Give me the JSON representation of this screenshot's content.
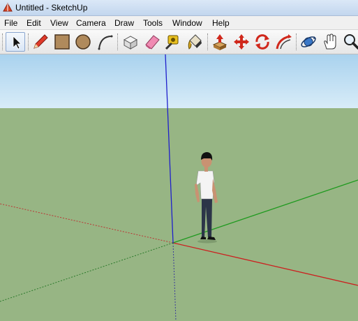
{
  "window": {
    "title": "Untitled - SketchUp",
    "app_icon": "sketchup-logo-icon"
  },
  "menu": [
    {
      "label": "File"
    },
    {
      "label": "Edit"
    },
    {
      "label": "View"
    },
    {
      "label": "Camera"
    },
    {
      "label": "Draw"
    },
    {
      "label": "Tools"
    },
    {
      "label": "Window"
    },
    {
      "label": "Help"
    }
  ],
  "toolbar": {
    "tools": [
      {
        "name": "select-tool",
        "icon": "arrow-cursor-icon"
      },
      {
        "name": "line-tool",
        "icon": "pencil-icon"
      },
      {
        "name": "rectangle-tool",
        "icon": "rectangle-icon"
      },
      {
        "name": "circle-tool",
        "icon": "circle-icon"
      },
      {
        "name": "arc-tool",
        "icon": "arc-icon"
      },
      {
        "name": "make-component-tool",
        "icon": "component-icon"
      },
      {
        "name": "eraser-tool",
        "icon": "eraser-icon"
      },
      {
        "name": "tape-measure-tool",
        "icon": "tape-measure-icon"
      },
      {
        "name": "paint-bucket-tool",
        "icon": "paint-bucket-icon"
      },
      {
        "name": "push-pull-tool",
        "icon": "push-pull-icon"
      },
      {
        "name": "move-tool",
        "icon": "move-icon"
      },
      {
        "name": "rotate-tool",
        "icon": "rotate-icon"
      },
      {
        "name": "follow-me-tool",
        "icon": "follow-me-icon"
      },
      {
        "name": "orbit-tool",
        "icon": "orbit-icon"
      },
      {
        "name": "pan-tool",
        "icon": "hand-icon"
      },
      {
        "name": "zoom-tool",
        "icon": "magnifier-icon"
      }
    ]
  },
  "viewport": {
    "sky_color": "#b6d9f0",
    "ground_color": "#97b584",
    "axis_colors": {
      "x": "#cc1f1f",
      "y": "#1f9a1f",
      "z": "#1f1fcc"
    }
  }
}
